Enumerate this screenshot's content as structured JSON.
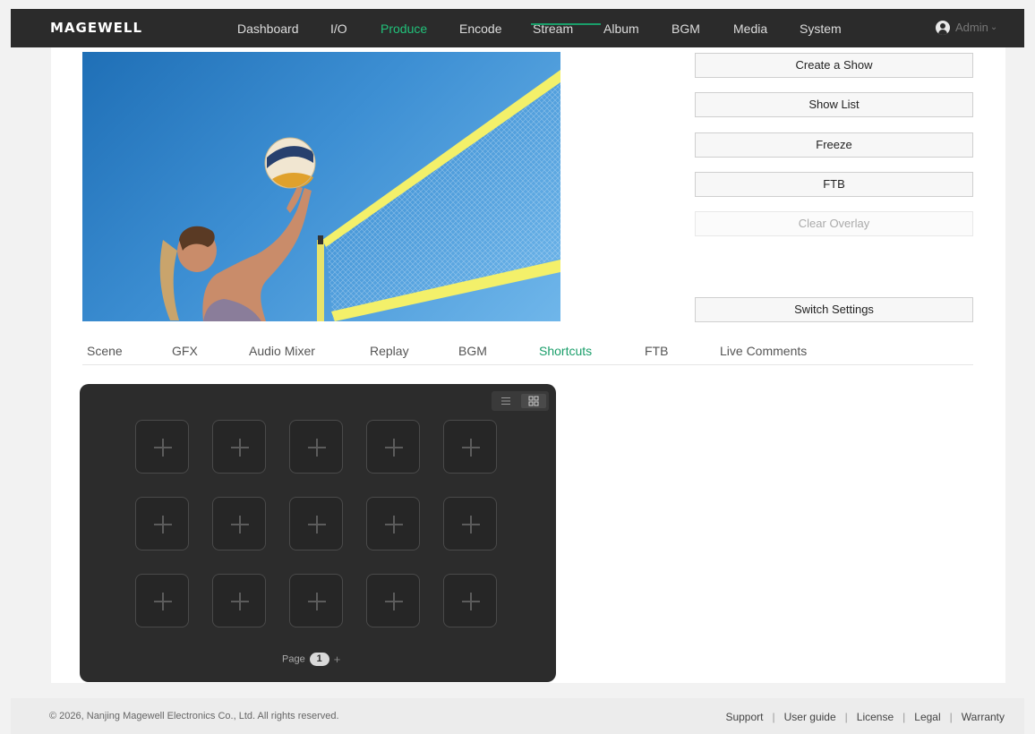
{
  "header": {
    "logo": "MAGEWELL",
    "nav": [
      {
        "label": "Dashboard",
        "active": false
      },
      {
        "label": "I/O",
        "active": false
      },
      {
        "label": "Produce",
        "active": true
      },
      {
        "label": "Encode",
        "active": false
      },
      {
        "label": "Stream",
        "active": false
      },
      {
        "label": "Album",
        "active": false
      },
      {
        "label": "BGM",
        "active": false
      },
      {
        "label": "Media",
        "active": false
      },
      {
        "label": "System",
        "active": false
      }
    ],
    "user": {
      "label": "Admin",
      "icon": "user-avatar-icon",
      "chevron": "⌄"
    }
  },
  "preview": {
    "icon": "video-preview"
  },
  "side_buttons": [
    {
      "label": "Create a Show",
      "enabled": true
    },
    {
      "label": "Show List",
      "enabled": true
    },
    {
      "label": "Freeze",
      "enabled": true
    },
    {
      "label": "FTB",
      "enabled": true
    },
    {
      "label": "Clear Overlay",
      "enabled": false
    },
    {
      "label": "Switch Settings",
      "enabled": true
    }
  ],
  "tabs": [
    {
      "label": "Scene",
      "active": false
    },
    {
      "label": "GFX",
      "active": false
    },
    {
      "label": "Audio Mixer",
      "active": false
    },
    {
      "label": "Replay",
      "active": false
    },
    {
      "label": "BGM",
      "active": false
    },
    {
      "label": "Shortcuts",
      "active": true
    },
    {
      "label": "FTB",
      "active": false
    },
    {
      "label": "Live Comments",
      "active": false
    }
  ],
  "shortcuts": {
    "slot_icon": "plus-icon",
    "view_modes": [
      "list-view-icon",
      "grid-view-icon"
    ],
    "selected_view": "grid",
    "pager": {
      "label": "Page",
      "current": "1",
      "add": "+"
    }
  },
  "footer": {
    "copyright": "© 2026, Nanjing Magewell Electronics Co., Ltd. All rights reserved.",
    "links": [
      "Support",
      "User guide",
      "License",
      "Legal",
      "Warranty"
    ],
    "separator": "|"
  },
  "colors": {
    "nav_bg": "#2b2b2b",
    "accent": "#21c17a",
    "tab_accent": "#1a9e6a",
    "panel_bg": "#2c2c2c"
  }
}
